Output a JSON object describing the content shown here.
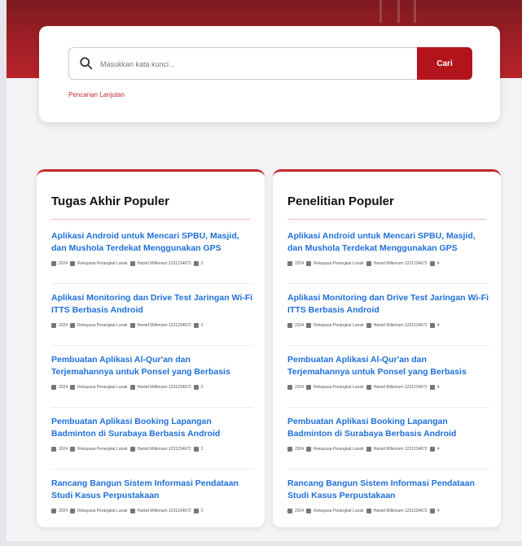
{
  "search": {
    "placeholder": "Masukkan kata kunci...",
    "button_label": "Cari",
    "advanced_link": "Pencarian Lanjutan"
  },
  "colors": {
    "primary": "#b3141c",
    "link": "#1e6fd9",
    "hero": "#a11f26"
  },
  "panels": [
    {
      "title": "Tugas Akhir Populer",
      "items": [
        {
          "title": "Aplikasi Android untuk Mencari SPBU, Masjid, dan Mushola Terdekat Menggunakan GPS",
          "year": "2024",
          "category": "Rekayasa Perangkat Lunak",
          "author": "Hamid Millenium 1231234672",
          "count": "2"
        },
        {
          "title": "Aplikasi Monitoring dan Drive Test Jaringan Wi-Fi ITTS Berbasis Android",
          "year": "2024",
          "category": "Rekayasa Perangkat Lunak",
          "author": "Hamid Millenium 1231234672",
          "count": "2"
        },
        {
          "title": "Pembuatan Aplikasi Al-Qur'an dan Terjemahannya untuk Ponsel yang Berbasis Android",
          "year": "2024",
          "category": "Rekayasa Perangkat Lunak",
          "author": "Hamid Millenium 1231234672",
          "count": "2"
        },
        {
          "title": "Pembuatan Aplikasi Booking Lapangan Badminton di Surabaya Berbasis Android",
          "year": "2024",
          "category": "Rekayasa Perangkat Lunak",
          "author": "Hamid Millenium 1231234672",
          "count": "2"
        },
        {
          "title": "Rancang Bangun Sistem Informasi Pendataan Studi Kasus Perpustakaan",
          "year": "2024",
          "category": "Rekayasa Perangkat Lunak",
          "author": "Hamid Millenium 1231234672",
          "count": "2"
        }
      ]
    },
    {
      "title": "Penelitian Populer",
      "items": [
        {
          "title": "Aplikasi Android untuk Mencari SPBU, Masjid, dan Mushola Terdekat Menggunakan GPS",
          "year": "2024",
          "category": "Rekayasa Perangkat Lunak",
          "author": "Hamid Millenium 1231234672",
          "count": "4"
        },
        {
          "title": "Aplikasi Monitoring dan Drive Test Jaringan Wi-Fi ITTS Berbasis Android",
          "year": "2024",
          "category": "Rekayasa Perangkat Lunak",
          "author": "Hamid Millenium 1231234672",
          "count": "4"
        },
        {
          "title": "Pembuatan Aplikasi Al-Qur'an dan Terjemahannya untuk Ponsel yang Berbasis Android",
          "year": "2024",
          "category": "Rekayasa Perangkat Lunak",
          "author": "Hamid Millenium 1231234672",
          "count": "4"
        },
        {
          "title": "Pembuatan Aplikasi Booking Lapangan Badminton di Surabaya Berbasis Android",
          "year": "2024",
          "category": "Rekayasa Perangkat Lunak",
          "author": "Hamid Millenium 1231234672",
          "count": "4"
        },
        {
          "title": "Rancang Bangun Sistem Informasi Pendataan Studi Kasus Perpustakaan",
          "year": "2024",
          "category": "Rekayasa Perangkat Lunak",
          "author": "Hamid Millenium 1231234672",
          "count": "4"
        }
      ]
    }
  ]
}
